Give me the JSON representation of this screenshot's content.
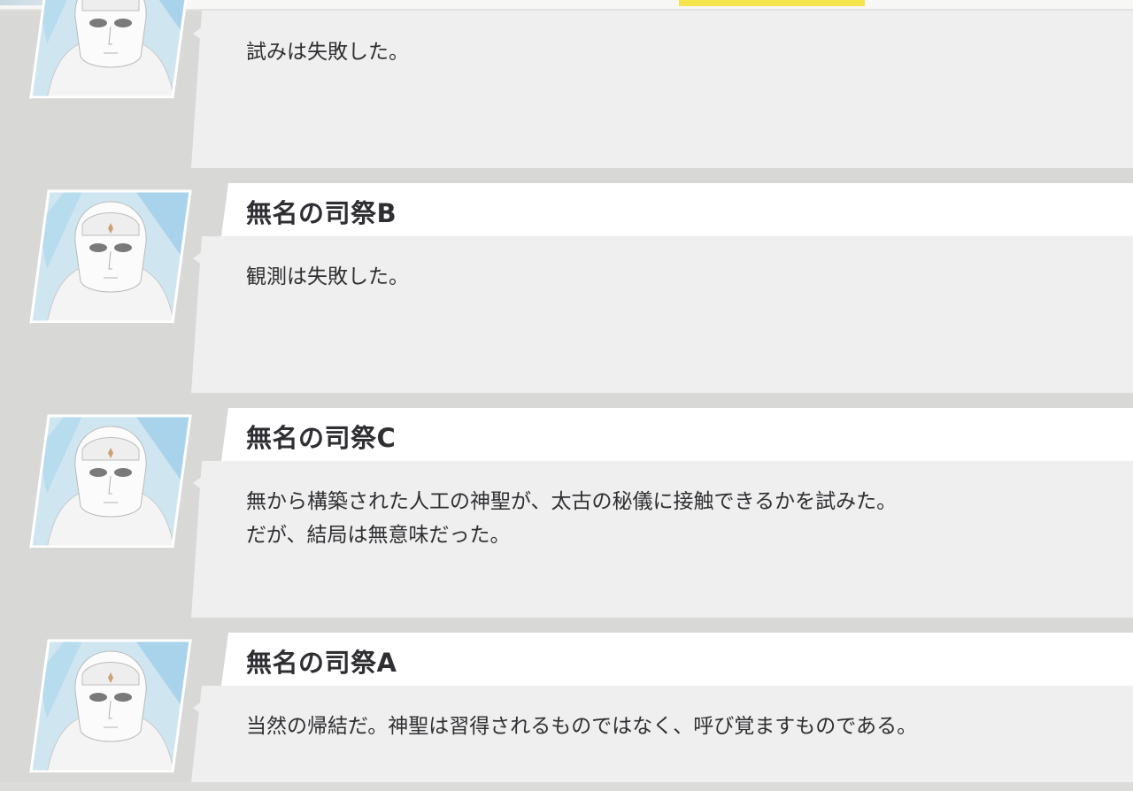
{
  "header": {
    "accent_color": "#f6e44c"
  },
  "log": [
    {
      "speaker": "",
      "portrait_icon": "masked-priest-portrait-icon",
      "text": "試みは失敗した。"
    },
    {
      "speaker": "無名の司祭B",
      "portrait_icon": "masked-priest-portrait-icon",
      "text": "観測は失敗した。"
    },
    {
      "speaker": "無名の司祭C",
      "portrait_icon": "masked-priest-portrait-icon",
      "text": "無から構築された人工の神聖が、太古の秘儀に接触できるかを試みた。\nだが、結局は無意味だった。"
    },
    {
      "speaker": "無名の司祭A",
      "portrait_icon": "masked-priest-portrait-icon",
      "text": "当然の帰結だ。神聖は習得されるものではなく、呼び覚ますものである。"
    }
  ]
}
